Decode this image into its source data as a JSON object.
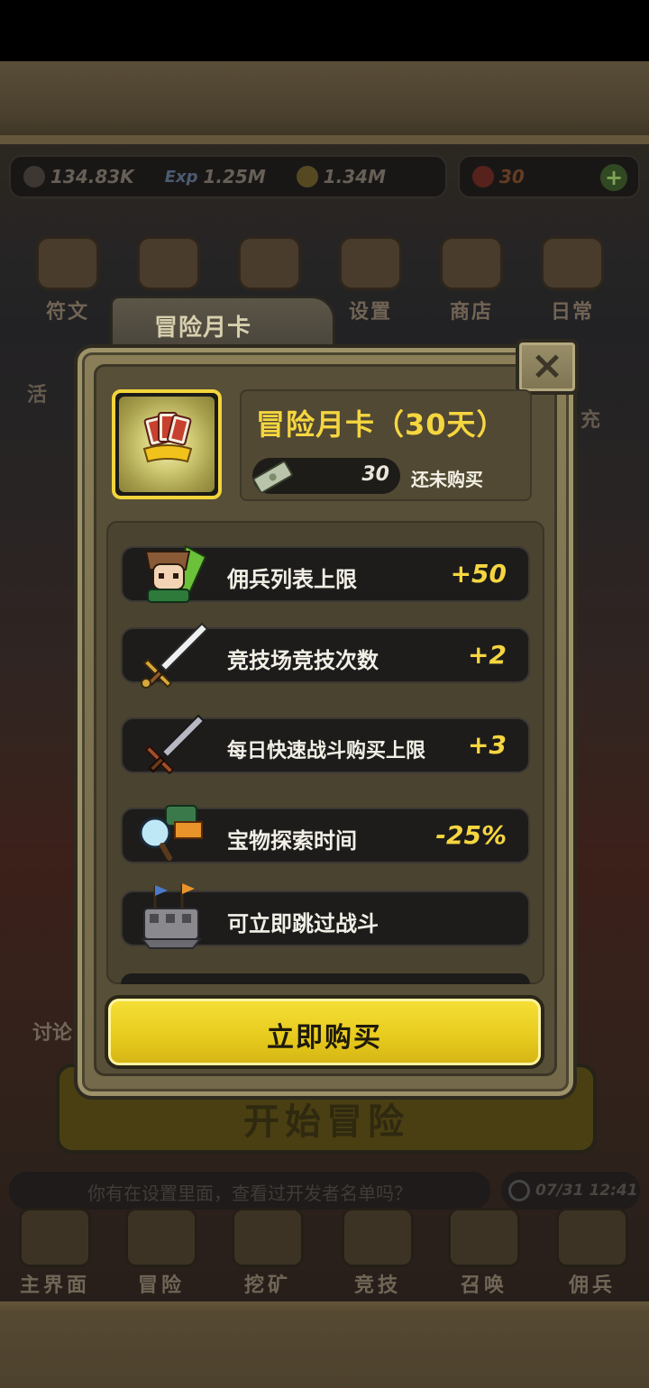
{
  "resources": {
    "attack": "134.83K",
    "exp_label": "Exp",
    "exp": "1.25M",
    "gold": "1.34M",
    "gems": "30"
  },
  "top_menu": [
    "符文",
    "",
    "",
    "设置",
    "商店",
    "日常"
  ],
  "side": {
    "left": "活",
    "right": "充",
    "discuss": "讨论"
  },
  "start_button": "开始冒险",
  "tip": "你有在设置里面，查看过开发者名单吗？",
  "clock": "07/31 12:41",
  "bottom_nav": [
    "主界面",
    "冒险",
    "挖矿",
    "竞技",
    "召唤",
    "佣兵"
  ],
  "modal": {
    "tab_label": "冒险月卡",
    "close_label": "×",
    "title": "冒险月卡（30天）",
    "price": "30",
    "status": "还未购买",
    "perks": [
      {
        "icon": "hero-portrait-icon",
        "label": "佣兵列表上限",
        "value": "+50"
      },
      {
        "icon": "sword-icon",
        "label": "竞技场竞技次数",
        "value": "+2"
      },
      {
        "icon": "dark-sword-icon",
        "label": "每日快速战斗购买上限",
        "value": "+3"
      },
      {
        "icon": "magnifier-treasure-icon",
        "label": "宝物探索时间",
        "value": "-25%"
      },
      {
        "icon": "castle-flags-icon",
        "label": "可立即跳过战斗",
        "value": ""
      }
    ],
    "buy_label": "立即购买"
  },
  "colors": {
    "accent_yellow": "#f6d640",
    "panel": "#7c7150",
    "row_bg": "#1d1c1b"
  }
}
